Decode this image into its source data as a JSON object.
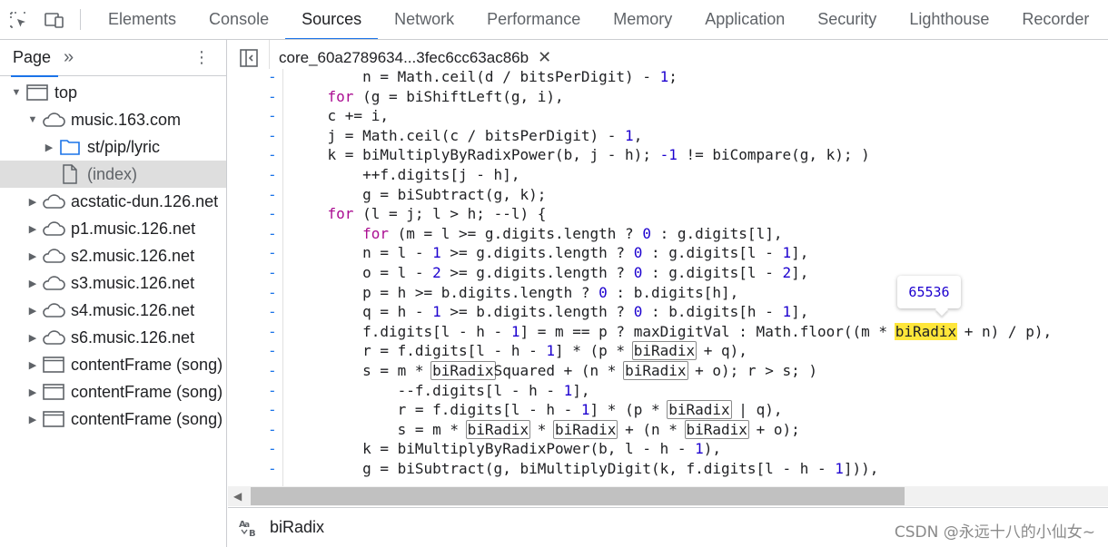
{
  "devtools_tabs": [
    "Elements",
    "Console",
    "Sources",
    "Network",
    "Performance",
    "Memory",
    "Application",
    "Security",
    "Lighthouse",
    "Recorder"
  ],
  "active_tab": "Sources",
  "navigator": {
    "page_tab": "Page",
    "more": "»",
    "menu": "⋮",
    "tree": [
      {
        "label": "top",
        "icon": "frame-icon",
        "expanded": true
      },
      {
        "label": "music.163.com",
        "icon": "cloud-icon",
        "expanded": true
      },
      {
        "label": "st/pip/lyric",
        "icon": "folder-icon",
        "expanded": false
      },
      {
        "label": "(index)",
        "icon": "file-icon",
        "selected": true
      },
      {
        "label": "acstatic-dun.126.net",
        "icon": "cloud-icon",
        "expanded": false
      },
      {
        "label": "p1.music.126.net",
        "icon": "cloud-icon",
        "expanded": false
      },
      {
        "label": "s2.music.126.net",
        "icon": "cloud-icon",
        "expanded": false
      },
      {
        "label": "s3.music.126.net",
        "icon": "cloud-icon",
        "expanded": false
      },
      {
        "label": "s4.music.126.net",
        "icon": "cloud-icon",
        "expanded": false
      },
      {
        "label": "s6.music.126.net",
        "icon": "cloud-icon",
        "expanded": false
      },
      {
        "label": "contentFrame (song)",
        "icon": "frame-icon",
        "expanded": false
      },
      {
        "label": "contentFrame (song)",
        "icon": "frame-icon",
        "expanded": false
      },
      {
        "label": "contentFrame (song)",
        "icon": "frame-icon",
        "expanded": false
      }
    ]
  },
  "editor": {
    "file_tab": "core_60a2789634...3fec6cc63ac86b",
    "close": "✕",
    "tooltip_value": "65536",
    "lines": [
      "        n = Math.ceil(d / bitsPerDigit) - 1;",
      "    for (g = biShiftLeft(g, i),",
      "    c += i,",
      "    j = Math.ceil(c / bitsPerDigit) - 1,",
      "    k = biMultiplyByRadixPower(b, j - h); -1 != biCompare(g, k); )",
      "        ++f.digits[j - h],",
      "        g = biSubtract(g, k);",
      "    for (l = j; l > h; --l) {",
      "        for (m = l >= g.digits.length ? 0 : g.digits[l],",
      "        n = l - 1 >= g.digits.length ? 0 : g.digits[l - 1],",
      "        o = l - 2 >= g.digits.length ? 0 : g.digits[l - 2],",
      "        p = h >= b.digits.length ? 0 : b.digits[h],",
      "        q = h - 1 >= b.digits.length ? 0 : b.digits[h - 1],",
      "        f.digits[l - h - 1] = m == p ? maxDigitVal : Math.floor((m * biRadix + n) / p),",
      "        r = f.digits[l - h - 1] * (p * biRadix + q),",
      "        s = m * biRadixSquared + (n * biRadix + o); r > s; )",
      "            --f.digits[l - h - 1],",
      "            r = f.digits[l - h - 1] * (p * biRadix | q),",
      "            s = m * biRadix * biRadix + (n * biRadix + o);",
      "        k = biMultiplyByRadixPower(b, l - h - 1),",
      "        g = biSubtract(g, biMultiplyDigit(k, f.digits[l - h - 1])),"
    ]
  },
  "search": {
    "icon": "Aa",
    "value": "biRadix"
  },
  "watermark": "CSDN @永远十八的小仙女~"
}
